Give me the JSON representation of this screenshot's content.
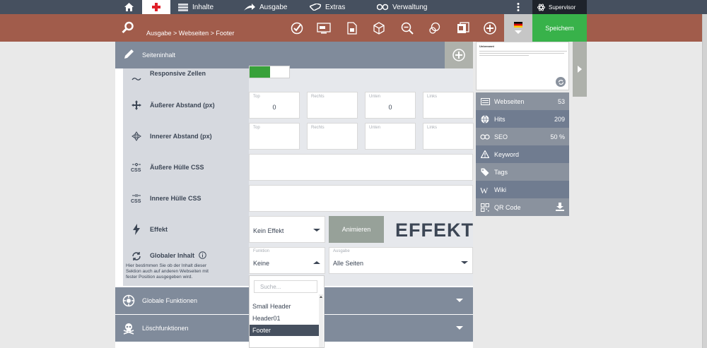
{
  "topnav": {
    "items": [
      {
        "label": "Inhalte",
        "icon": "content-icon"
      },
      {
        "label": "Ausgabe",
        "icon": "output-icon"
      },
      {
        "label": "Extras",
        "icon": "extras-icon"
      },
      {
        "label": "Verwaltung",
        "icon": "admin-icon"
      }
    ],
    "user": "Supervisor"
  },
  "toolbar": {
    "breadcrumb": "Ausgabe > Webseiten > Footer",
    "save_label": "Speichern",
    "colors": {
      "bar": "#a15c4b",
      "save": "#38b24a"
    }
  },
  "panel": {
    "title": "Seiteninhalt"
  },
  "rows": {
    "responsive": {
      "label": "Responsive Zellen",
      "enabled": true
    },
    "outer_spacing": {
      "label": "Äußerer Abstand (px)",
      "top_label": "Top",
      "top_value": "0",
      "right_label": "Rechts",
      "right_value": "",
      "bottom_label": "Unten",
      "bottom_value": "0",
      "left_label": "Links",
      "left_value": ""
    },
    "inner_spacing": {
      "label": "Innerer Abstand (px)",
      "top_label": "Top",
      "right_label": "Rechts",
      "bottom_label": "Unten",
      "left_label": "Links"
    },
    "outer_css": {
      "label": "Äußere Hülle CSS",
      "value": ""
    },
    "inner_css": {
      "label": "Innere Hülle CSS",
      "value": ""
    },
    "effect": {
      "label": "Effekt",
      "value": "Kein Effekt",
      "animate_label": "Animieren",
      "preview_text": "EFFEKT"
    },
    "global": {
      "label": "Globaler Inhalt",
      "help": "Hier bestimmen Sie ob der Inhalt dieser Sektion auch auf anderen Webseiten mit fester Position ausgegeben wird.",
      "function_label": "Funktion",
      "function_value": "Keine",
      "output_label": "Ausgabe",
      "output_value": "Alle Seiten"
    }
  },
  "dropdown": {
    "search_placeholder": "Suche...",
    "options": [
      "Small Header",
      "Header01",
      "Footer"
    ],
    "selected": "Footer"
  },
  "sections": {
    "global_functions": "Globale Funktionen",
    "delete_functions": "Löschfunktionen"
  },
  "preview": {
    "title": "Unbenannt"
  },
  "stats": {
    "webseiten": {
      "label": "Webseiten",
      "value": "53"
    },
    "hits": {
      "label": "Hits",
      "value": "209"
    },
    "seo": {
      "label": "SEO",
      "value": "50 %"
    },
    "keyword": {
      "label": "Keyword"
    },
    "tags": {
      "label": "Tags"
    },
    "wiki": {
      "label": "Wiki"
    },
    "qrcode": {
      "label": "QR Code"
    }
  }
}
